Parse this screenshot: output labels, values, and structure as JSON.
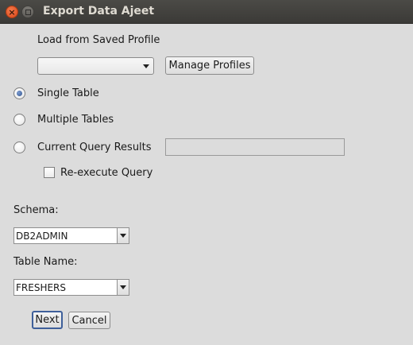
{
  "window": {
    "title": "Export Data Ajeet",
    "close_glyph": "×"
  },
  "profile": {
    "label": "Load from Saved Profile",
    "selected": "",
    "manage_button": "Manage Profiles"
  },
  "mode": {
    "options": [
      {
        "label": "Single Table",
        "checked": true
      },
      {
        "label": "Multiple Tables",
        "checked": false
      },
      {
        "label": "Current Query Results",
        "checked": false
      }
    ],
    "query_results_value": "",
    "reexecute_label": "Re-execute Query",
    "reexecute_checked": false
  },
  "schema": {
    "label": "Schema:",
    "value": "DB2ADMIN"
  },
  "table": {
    "label": "Table Name:",
    "value": "FRESHERS"
  },
  "buttons": {
    "next": "Next",
    "cancel": "Cancel"
  }
}
